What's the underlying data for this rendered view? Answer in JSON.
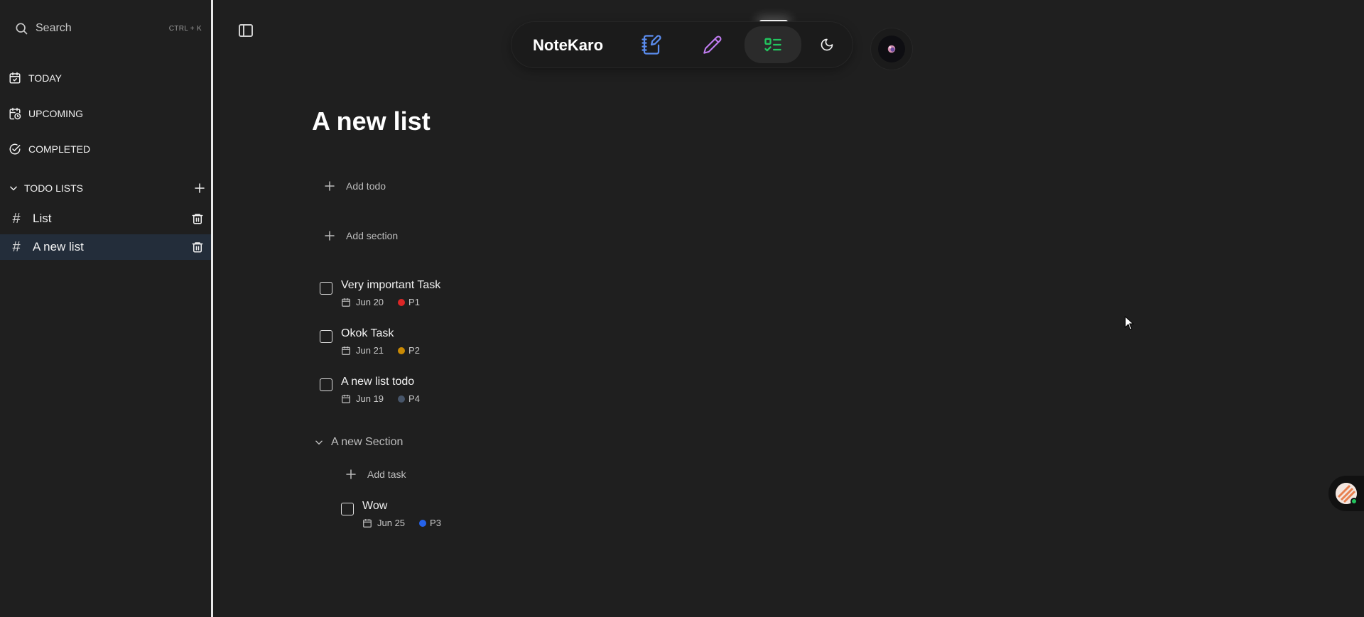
{
  "sidebar": {
    "search": {
      "label": "Search",
      "shortcut": "CTRL + K"
    },
    "nav": [
      {
        "label": "TODAY",
        "icon": "calendar-check-icon"
      },
      {
        "label": "UPCOMING",
        "icon": "calendar-clock-icon"
      },
      {
        "label": "COMPLETED",
        "icon": "check-circle-icon"
      }
    ],
    "todo_lists_header": "TODO LISTS",
    "lists": [
      {
        "label": "List",
        "active": false
      },
      {
        "label": "A new list",
        "active": true
      }
    ]
  },
  "topbar": {
    "brand": "NoteKaro",
    "buttons": [
      {
        "icon": "notebook-pen-icon",
        "color": "#5b8def"
      },
      {
        "icon": "pencil-icon",
        "color": "#c07cf0"
      },
      {
        "icon": "list-todo-icon",
        "color": "#22c55e",
        "active": true
      },
      {
        "icon": "moon-icon",
        "color": "#f0f0f0"
      }
    ]
  },
  "main": {
    "title": "A new list",
    "add_todo": "Add todo",
    "add_section": "Add section",
    "todos": [
      {
        "title": "Very important Task",
        "date": "Jun 20",
        "priority": "P1",
        "color": "#dc2626"
      },
      {
        "title": "Okok Task",
        "date": "Jun 21",
        "priority": "P2",
        "color": "#ca8a04"
      },
      {
        "title": "A new list todo",
        "date": "Jun 19",
        "priority": "P4",
        "color": "#475569"
      }
    ],
    "section": {
      "title": "A new Section",
      "add_task": "Add task",
      "todos": [
        {
          "title": "Wow",
          "date": "Jun 25",
          "priority": "P3",
          "color": "#2563eb"
        }
      ]
    }
  }
}
